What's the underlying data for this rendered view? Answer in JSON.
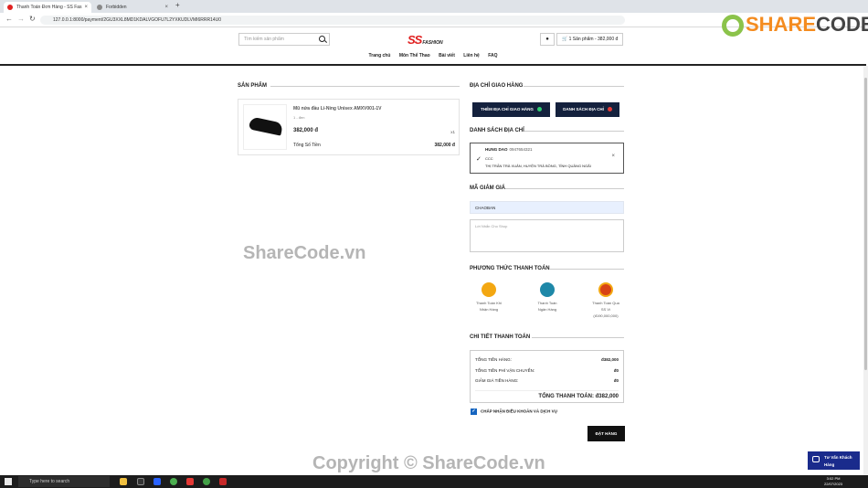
{
  "browser": {
    "tabs": [
      {
        "label": "Thanh Toán Đơn Hàng - SS Fas",
        "active": true
      },
      {
        "label": "Forbidden",
        "active": false
      }
    ],
    "url": "127.0.0.1:8000/payment/2GU3XXL8MD1KDALVGOFU7L2YXKUDLVMI6RRR14U0"
  },
  "header": {
    "search_placeholder": "Tìm kiếm sản phẩm",
    "logo": "SS",
    "logo_sub": "FASHION",
    "cart": "1 Sản phẩm - 382,000 đ",
    "menu": [
      "Trang chủ",
      "Môn Thể Thao",
      "Bài viết",
      "Liên hệ",
      "FAQ"
    ]
  },
  "products": {
    "title": "SẢN PHẨM",
    "item": {
      "name": "Mũ nửa đầu Li-Ning Unisex AMXV001-1V",
      "variant": "1 - đen",
      "price": "382,000 đ",
      "qty": "x1"
    },
    "total_label": "Tổng Số Tiền",
    "total_value": "382,000 đ"
  },
  "address": {
    "title": "ĐỊA CHỈ GIAO HÀNG",
    "add_btn": "THÊM ĐỊA CHỈ GIAO HÀNG",
    "list_btn": "DANH SÁCH ĐỊA CHỈ",
    "list_title": "DANH SÁCH ĐỊA CHỈ",
    "entry": {
      "name": "HUNG DAO",
      "phone": "0947654321",
      "line1": "CCC",
      "line2": "THỊ TRẤN TRÀ XUÂN, HUYỆN TRÀ BỒNG, TỈNH QUẢNG NGÃI"
    }
  },
  "coupon": {
    "title": "MÃ GIẢM GIÁ",
    "value": "CHAOBAN",
    "note_placeholder": "Lời Nhắn Cho Shop"
  },
  "payment": {
    "title": "PHƯƠNG THỨC THANH TOÁN",
    "methods": [
      {
        "label1": "Thanh Toán Khi",
        "label2": "Nhận Hàng",
        "label3": "",
        "color": "#f3a712"
      },
      {
        "label1": "Thanh Toán",
        "label2": "Ngân Hàng",
        "label3": "",
        "color": "#1e88a8"
      },
      {
        "label1": "Thanh Toán Qua",
        "label2": "SS Ví",
        "label3": "(đ190,000,000)",
        "color": "#d84315"
      }
    ]
  },
  "details": {
    "title": "CHI TIẾT THANH TOÁN",
    "rows": [
      {
        "label": "TỔNG TIỀN HÀNG:",
        "value": "đ382,000"
      },
      {
        "label": "TỔNG TIỀN PHÍ VẬN CHUYỂN:",
        "value": "đ0"
      },
      {
        "label": "GIẢM GIÁ TIỀN HÀNG:",
        "value": "đ0"
      }
    ],
    "total": "TỔNG THANH TOÁN: đ382,000",
    "terms": "CHẤP NHẬN ĐIỀU KHOẢN VÀ DỊCH VỤ",
    "order_btn": "ĐẶT HÀNG"
  },
  "chat": {
    "line1": "Tư Vấn Khách",
    "line2": "Hàng"
  },
  "watermarks": {
    "center": "ShareCode.vn",
    "bottom": "Copyright © ShareCode.vn",
    "brand_a": "SHARE",
    "brand_b": "CODE.vn"
  },
  "taskbar": {
    "search": "Type here to search",
    "time": "3:02 PM",
    "date": "22/07/2023"
  }
}
